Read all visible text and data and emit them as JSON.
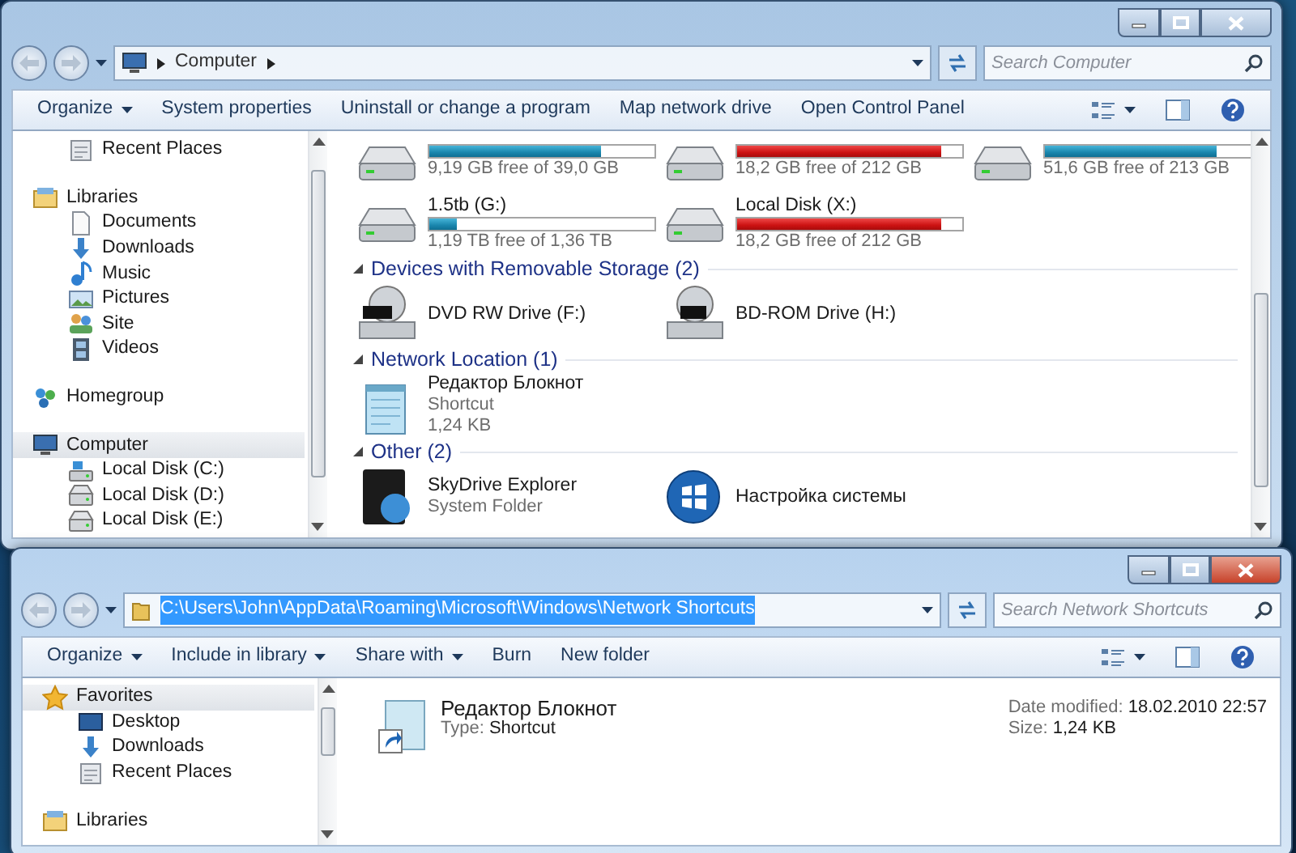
{
  "computer_window": {
    "active": false,
    "breadcrumb": [
      "Computer"
    ],
    "search": {
      "placeholder": "Search Computer"
    },
    "commands": [
      {
        "label": "Organize",
        "dropdown": true
      },
      {
        "label": "System properties",
        "dropdown": false
      },
      {
        "label": "Uninstall or change a program",
        "dropdown": false
      },
      {
        "label": "Map network drive",
        "dropdown": false
      },
      {
        "label": "Open Control Panel",
        "dropdown": false
      }
    ],
    "sidebar": [
      {
        "children": [
          {
            "label": "Recent Places",
            "kind": "recent",
            "selected": false
          }
        ]
      },
      {
        "label": "Libraries",
        "kind": "library",
        "selected": false,
        "children": [
          {
            "label": "Documents",
            "kind": "documents",
            "selected": false
          },
          {
            "label": "Downloads",
            "kind": "downloads",
            "selected": false
          },
          {
            "label": "Music",
            "kind": "music",
            "selected": false
          },
          {
            "label": "Pictures",
            "kind": "pictures",
            "selected": false
          },
          {
            "label": "Site",
            "kind": "site",
            "selected": false
          },
          {
            "label": "Videos",
            "kind": "videos",
            "selected": false
          }
        ]
      },
      {
        "label": "Homegroup",
        "kind": "homegroup",
        "selected": false
      },
      {
        "label": "Computer",
        "kind": "computer",
        "selected": true,
        "children": [
          {
            "label": "Local Disk (C:)",
            "kind": "system-disk",
            "selected": false
          },
          {
            "label": "Local Disk (D:)",
            "kind": "disk",
            "selected": false
          },
          {
            "label": "Local Disk (E:)",
            "kind": "disk",
            "selected": false
          }
        ]
      }
    ],
    "drives": [
      {
        "free": "9,19 GB free of 39,0 GB",
        "level": 0.76,
        "low_space": false
      },
      {
        "free": "18,2 GB free of 212 GB",
        "level": 0.91,
        "low_space": true
      },
      {
        "free": "51,6 GB free of 213 GB",
        "level": 0.76,
        "low_space": false
      },
      {
        "name": "1.5tb (G:)",
        "free": "1,19 TB free of 1,36 TB",
        "level": 0.12,
        "low_space": false
      },
      {
        "name": "Local Disk (X:)",
        "free": "18,2 GB free of 212 GB",
        "level": 0.91,
        "low_space": true
      }
    ],
    "groups": [
      {
        "title": "Devices with Removable Storage (2)",
        "items": [
          {
            "kind": "dvd",
            "name": "DVD RW Drive (F:)"
          },
          {
            "kind": "bd",
            "name": "BD-ROM Drive (H:)"
          }
        ]
      },
      {
        "title": "Network Location (1)",
        "items": [
          {
            "kind": "notepad",
            "name": "Редактор Блокнот",
            "lines": [
              "Shortcut",
              "1,24 KB"
            ]
          }
        ]
      },
      {
        "title": "Other (2)",
        "items": [
          {
            "kind": "system-folder",
            "name": "SkyDrive Explorer",
            "lines": [
              "System Folder"
            ]
          },
          {
            "kind": "orb",
            "name": "Настройка системы"
          }
        ]
      }
    ]
  },
  "shortcuts_window": {
    "active": true,
    "address": {
      "text": "C:\\Users\\John\\AppData\\Roaming\\Microsoft\\Windows\\Network Shortcuts",
      "selected": true
    },
    "search": {
      "placeholder": "Search Network Shortcuts"
    },
    "commands": [
      {
        "label": "Organize",
        "dropdown": true
      },
      {
        "label": "Include in library",
        "dropdown": true
      },
      {
        "label": "Share with",
        "dropdown": true
      },
      {
        "label": "Burn",
        "dropdown": false
      },
      {
        "label": "New folder",
        "dropdown": false
      }
    ],
    "sidebar": [
      {
        "label": "Favorites",
        "kind": "favorites",
        "selected": true,
        "children": [
          {
            "label": "Desktop",
            "kind": "desktop",
            "selected": false
          },
          {
            "label": "Downloads",
            "kind": "downloads",
            "selected": false
          },
          {
            "label": "Recent Places",
            "kind": "recent",
            "selected": false
          }
        ]
      },
      {
        "label": "Libraries",
        "kind": "library",
        "selected": false
      }
    ],
    "file": {
      "name": "Редактор Блокнот",
      "details": [
        {
          "label": "Type:",
          "value": "Shortcut"
        }
      ],
      "meta": [
        {
          "label": "Date modified:",
          "value": "18.02.2010 22:57"
        },
        {
          "label": "Size:",
          "value": "1,24 KB"
        }
      ]
    }
  }
}
